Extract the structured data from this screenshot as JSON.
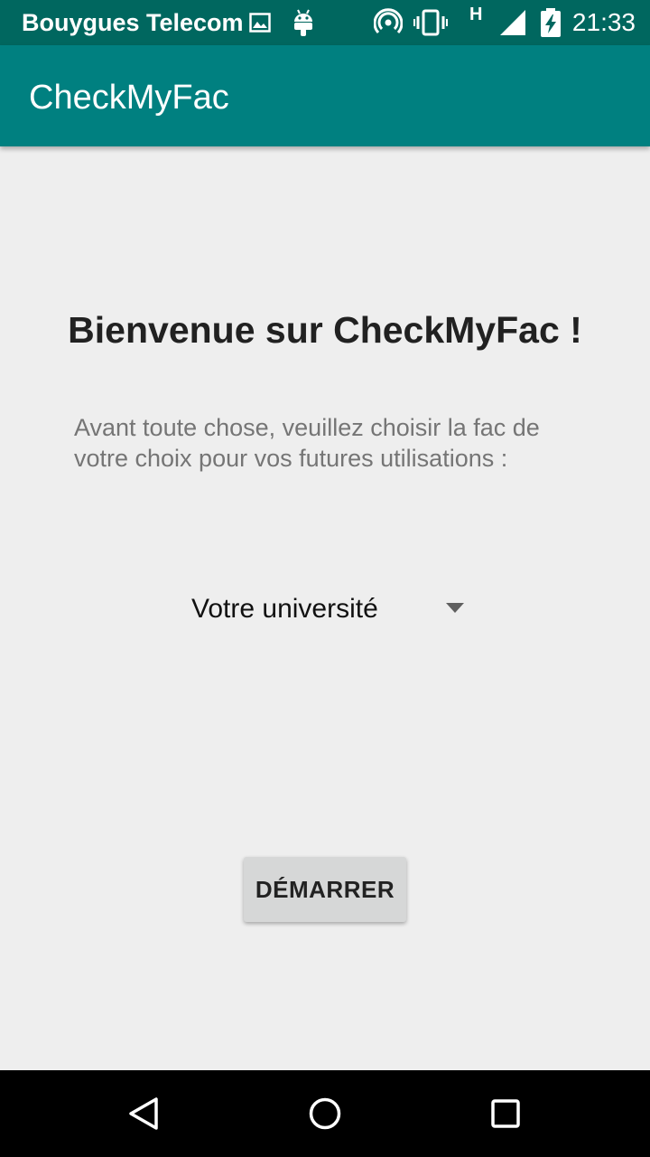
{
  "status_bar": {
    "carrier": "Bouygues Telecom",
    "network_type": "H",
    "time": "21:33",
    "icons": [
      "image-notification-icon",
      "android-debug-icon",
      "hotspot-icon",
      "vibrate-icon",
      "signal-icon",
      "battery-charging-icon"
    ]
  },
  "app_bar": {
    "title": "CheckMyFac"
  },
  "main": {
    "welcome": "Bienvenue sur CheckMyFac !",
    "intro": "Avant toute chose, veuillez choisir la fac de votre choix pour vos futures utilisations :",
    "spinner": {
      "selected": "Votre université"
    },
    "start_button": "DÉMARRER"
  },
  "nav_bar": {
    "icons": [
      "back-icon",
      "home-icon",
      "recents-icon"
    ]
  },
  "colors": {
    "status_bar": "#00675f",
    "app_bar": "#008080",
    "background": "#eeeeee",
    "button": "#d6d7d7"
  }
}
